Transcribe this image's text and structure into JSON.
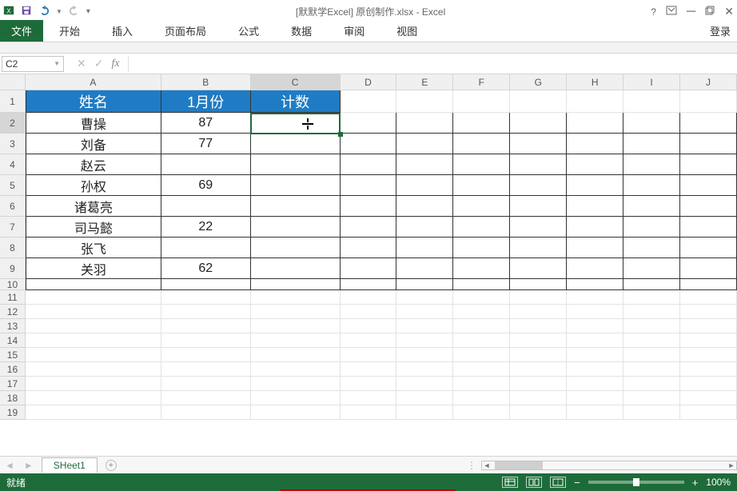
{
  "title_text": "[默默学Excel] 原创制作.xlsx - Excel",
  "ribbon": {
    "file": "文件",
    "tabs": [
      "开始",
      "插入",
      "页面布局",
      "公式",
      "数据",
      "审阅",
      "视图"
    ],
    "login": "登录",
    "help_icon": "?"
  },
  "formula_bar": {
    "name_box": "C2",
    "fx_label": "fx",
    "formula": ""
  },
  "columns": [
    "A",
    "B",
    "C",
    "D",
    "E",
    "F",
    "G",
    "H",
    "I",
    "J"
  ],
  "active_cell": "C2",
  "headers": {
    "A": "姓名",
    "B": "1月份",
    "C": "计数"
  },
  "data_rows": [
    {
      "A": "曹操",
      "B": "87",
      "C": ""
    },
    {
      "A": "刘备",
      "B": "77",
      "C": ""
    },
    {
      "A": "赵云",
      "B": "",
      "C": ""
    },
    {
      "A": "孙权",
      "B": "69",
      "C": ""
    },
    {
      "A": "诸葛亮",
      "B": "",
      "C": ""
    },
    {
      "A": "司马懿",
      "B": "22",
      "C": ""
    },
    {
      "A": "张飞",
      "B": "",
      "C": ""
    },
    {
      "A": "关羽",
      "B": "62",
      "C": ""
    }
  ],
  "row_labels": [
    "1",
    "2",
    "3",
    "4",
    "5",
    "6",
    "7",
    "8",
    "9",
    "10",
    "11",
    "12",
    "13",
    "14",
    "15",
    "16",
    "17",
    "18",
    "19"
  ],
  "sheet_tab": {
    "name": "SHeet1",
    "add": "+"
  },
  "statusbar": {
    "ready": "就绪",
    "zoom": "100%"
  },
  "chart_data": {
    "type": "table",
    "title": "",
    "columns": [
      "姓名",
      "1月份",
      "计数"
    ],
    "rows": [
      [
        "曹操",
        87,
        null
      ],
      [
        "刘备",
        77,
        null
      ],
      [
        "赵云",
        null,
        null
      ],
      [
        "孙权",
        69,
        null
      ],
      [
        "诸葛亮",
        null,
        null
      ],
      [
        "司马懿",
        22,
        null
      ],
      [
        "张飞",
        null,
        null
      ],
      [
        "关羽",
        62,
        null
      ]
    ]
  }
}
